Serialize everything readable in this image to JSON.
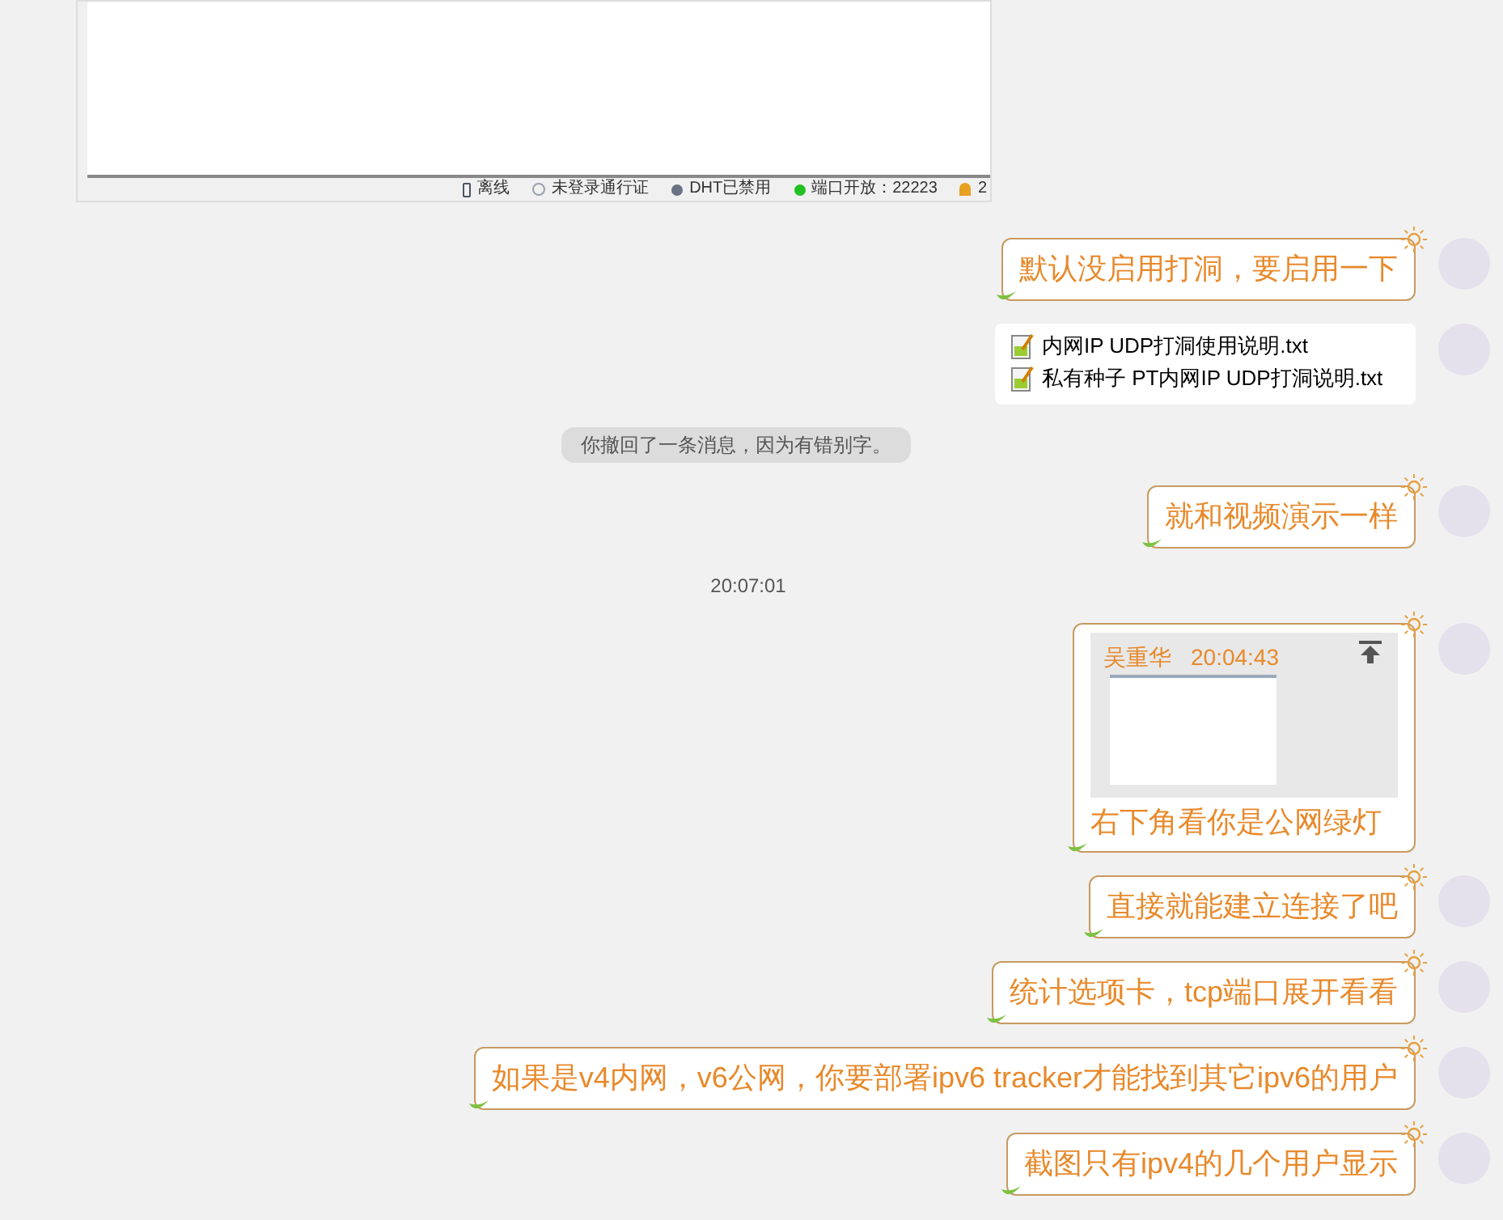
{
  "screenshot": {
    "status_items": [
      {
        "kind": "phone",
        "text": "离线"
      },
      {
        "kind": "globe",
        "text": "未登录通行证"
      },
      {
        "kind": "gear",
        "text": "DHT已禁用"
      },
      {
        "kind": "dot",
        "text": "端口开放：22223"
      },
      {
        "kind": "bell",
        "text": "2"
      }
    ]
  },
  "messages": [
    {
      "kind": "text",
      "text": "默认没启用打洞，要启用一下"
    },
    {
      "kind": "files",
      "files": [
        "内网IP UDP打洞使用说明.txt",
        "私有种子 PT内网IP UDP打洞说明.txt"
      ]
    },
    {
      "kind": "recall",
      "text": "你撤回了一条消息，因为有错别字。"
    },
    {
      "kind": "text",
      "text": "就和视频演示一样"
    },
    {
      "kind": "time",
      "text": "20:07:01"
    },
    {
      "kind": "image",
      "sender": "吴重华",
      "time": "20:04:43",
      "text": "右下角看你是公网绿灯"
    },
    {
      "kind": "text",
      "text": "直接就能建立连接了吧"
    },
    {
      "kind": "text",
      "text": "统计选项卡，tcp端口展开看看"
    },
    {
      "kind": "text",
      "text": "如果是v4内网，v6公网，你要部署ipv6 tracker才能找到其它ipv6的用户"
    },
    {
      "kind": "text",
      "text": "截图只有ipv4的几个用户显示"
    }
  ]
}
